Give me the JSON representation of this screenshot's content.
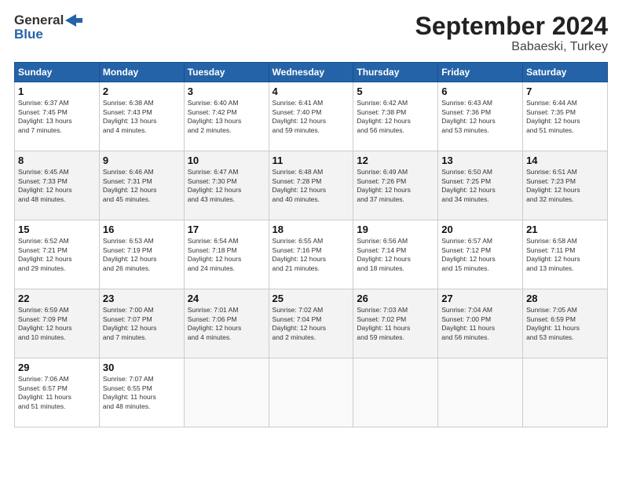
{
  "header": {
    "logo_line1": "General",
    "logo_line2": "Blue",
    "title": "September 2024",
    "subtitle": "Babaeski, Turkey"
  },
  "columns": [
    "Sunday",
    "Monday",
    "Tuesday",
    "Wednesday",
    "Thursday",
    "Friday",
    "Saturday"
  ],
  "weeks": [
    [
      {
        "day": "1",
        "lines": [
          "Sunrise: 6:37 AM",
          "Sunset: 7:45 PM",
          "Daylight: 13 hours",
          "and 7 minutes."
        ]
      },
      {
        "day": "2",
        "lines": [
          "Sunrise: 6:38 AM",
          "Sunset: 7:43 PM",
          "Daylight: 13 hours",
          "and 4 minutes."
        ]
      },
      {
        "day": "3",
        "lines": [
          "Sunrise: 6:40 AM",
          "Sunset: 7:42 PM",
          "Daylight: 13 hours",
          "and 2 minutes."
        ]
      },
      {
        "day": "4",
        "lines": [
          "Sunrise: 6:41 AM",
          "Sunset: 7:40 PM",
          "Daylight: 12 hours",
          "and 59 minutes."
        ]
      },
      {
        "day": "5",
        "lines": [
          "Sunrise: 6:42 AM",
          "Sunset: 7:38 PM",
          "Daylight: 12 hours",
          "and 56 minutes."
        ]
      },
      {
        "day": "6",
        "lines": [
          "Sunrise: 6:43 AM",
          "Sunset: 7:36 PM",
          "Daylight: 12 hours",
          "and 53 minutes."
        ]
      },
      {
        "day": "7",
        "lines": [
          "Sunrise: 6:44 AM",
          "Sunset: 7:35 PM",
          "Daylight: 12 hours",
          "and 51 minutes."
        ]
      }
    ],
    [
      {
        "day": "8",
        "lines": [
          "Sunrise: 6:45 AM",
          "Sunset: 7:33 PM",
          "Daylight: 12 hours",
          "and 48 minutes."
        ]
      },
      {
        "day": "9",
        "lines": [
          "Sunrise: 6:46 AM",
          "Sunset: 7:31 PM",
          "Daylight: 12 hours",
          "and 45 minutes."
        ]
      },
      {
        "day": "10",
        "lines": [
          "Sunrise: 6:47 AM",
          "Sunset: 7:30 PM",
          "Daylight: 12 hours",
          "and 43 minutes."
        ]
      },
      {
        "day": "11",
        "lines": [
          "Sunrise: 6:48 AM",
          "Sunset: 7:28 PM",
          "Daylight: 12 hours",
          "and 40 minutes."
        ]
      },
      {
        "day": "12",
        "lines": [
          "Sunrise: 6:49 AM",
          "Sunset: 7:26 PM",
          "Daylight: 12 hours",
          "and 37 minutes."
        ]
      },
      {
        "day": "13",
        "lines": [
          "Sunrise: 6:50 AM",
          "Sunset: 7:25 PM",
          "Daylight: 12 hours",
          "and 34 minutes."
        ]
      },
      {
        "day": "14",
        "lines": [
          "Sunrise: 6:51 AM",
          "Sunset: 7:23 PM",
          "Daylight: 12 hours",
          "and 32 minutes."
        ]
      }
    ],
    [
      {
        "day": "15",
        "lines": [
          "Sunrise: 6:52 AM",
          "Sunset: 7:21 PM",
          "Daylight: 12 hours",
          "and 29 minutes."
        ]
      },
      {
        "day": "16",
        "lines": [
          "Sunrise: 6:53 AM",
          "Sunset: 7:19 PM",
          "Daylight: 12 hours",
          "and 26 minutes."
        ]
      },
      {
        "day": "17",
        "lines": [
          "Sunrise: 6:54 AM",
          "Sunset: 7:18 PM",
          "Daylight: 12 hours",
          "and 24 minutes."
        ]
      },
      {
        "day": "18",
        "lines": [
          "Sunrise: 6:55 AM",
          "Sunset: 7:16 PM",
          "Daylight: 12 hours",
          "and 21 minutes."
        ]
      },
      {
        "day": "19",
        "lines": [
          "Sunrise: 6:56 AM",
          "Sunset: 7:14 PM",
          "Daylight: 12 hours",
          "and 18 minutes."
        ]
      },
      {
        "day": "20",
        "lines": [
          "Sunrise: 6:57 AM",
          "Sunset: 7:12 PM",
          "Daylight: 12 hours",
          "and 15 minutes."
        ]
      },
      {
        "day": "21",
        "lines": [
          "Sunrise: 6:58 AM",
          "Sunset: 7:11 PM",
          "Daylight: 12 hours",
          "and 13 minutes."
        ]
      }
    ],
    [
      {
        "day": "22",
        "lines": [
          "Sunrise: 6:59 AM",
          "Sunset: 7:09 PM",
          "Daylight: 12 hours",
          "and 10 minutes."
        ]
      },
      {
        "day": "23",
        "lines": [
          "Sunrise: 7:00 AM",
          "Sunset: 7:07 PM",
          "Daylight: 12 hours",
          "and 7 minutes."
        ]
      },
      {
        "day": "24",
        "lines": [
          "Sunrise: 7:01 AM",
          "Sunset: 7:06 PM",
          "Daylight: 12 hours",
          "and 4 minutes."
        ]
      },
      {
        "day": "25",
        "lines": [
          "Sunrise: 7:02 AM",
          "Sunset: 7:04 PM",
          "Daylight: 12 hours",
          "and 2 minutes."
        ]
      },
      {
        "day": "26",
        "lines": [
          "Sunrise: 7:03 AM",
          "Sunset: 7:02 PM",
          "Daylight: 11 hours",
          "and 59 minutes."
        ]
      },
      {
        "day": "27",
        "lines": [
          "Sunrise: 7:04 AM",
          "Sunset: 7:00 PM",
          "Daylight: 11 hours",
          "and 56 minutes."
        ]
      },
      {
        "day": "28",
        "lines": [
          "Sunrise: 7:05 AM",
          "Sunset: 6:59 PM",
          "Daylight: 11 hours",
          "and 53 minutes."
        ]
      }
    ],
    [
      {
        "day": "29",
        "lines": [
          "Sunrise: 7:06 AM",
          "Sunset: 6:57 PM",
          "Daylight: 11 hours",
          "and 51 minutes."
        ]
      },
      {
        "day": "30",
        "lines": [
          "Sunrise: 7:07 AM",
          "Sunset: 6:55 PM",
          "Daylight: 11 hours",
          "and 48 minutes."
        ]
      },
      {
        "day": "",
        "lines": []
      },
      {
        "day": "",
        "lines": []
      },
      {
        "day": "",
        "lines": []
      },
      {
        "day": "",
        "lines": []
      },
      {
        "day": "",
        "lines": []
      }
    ]
  ]
}
